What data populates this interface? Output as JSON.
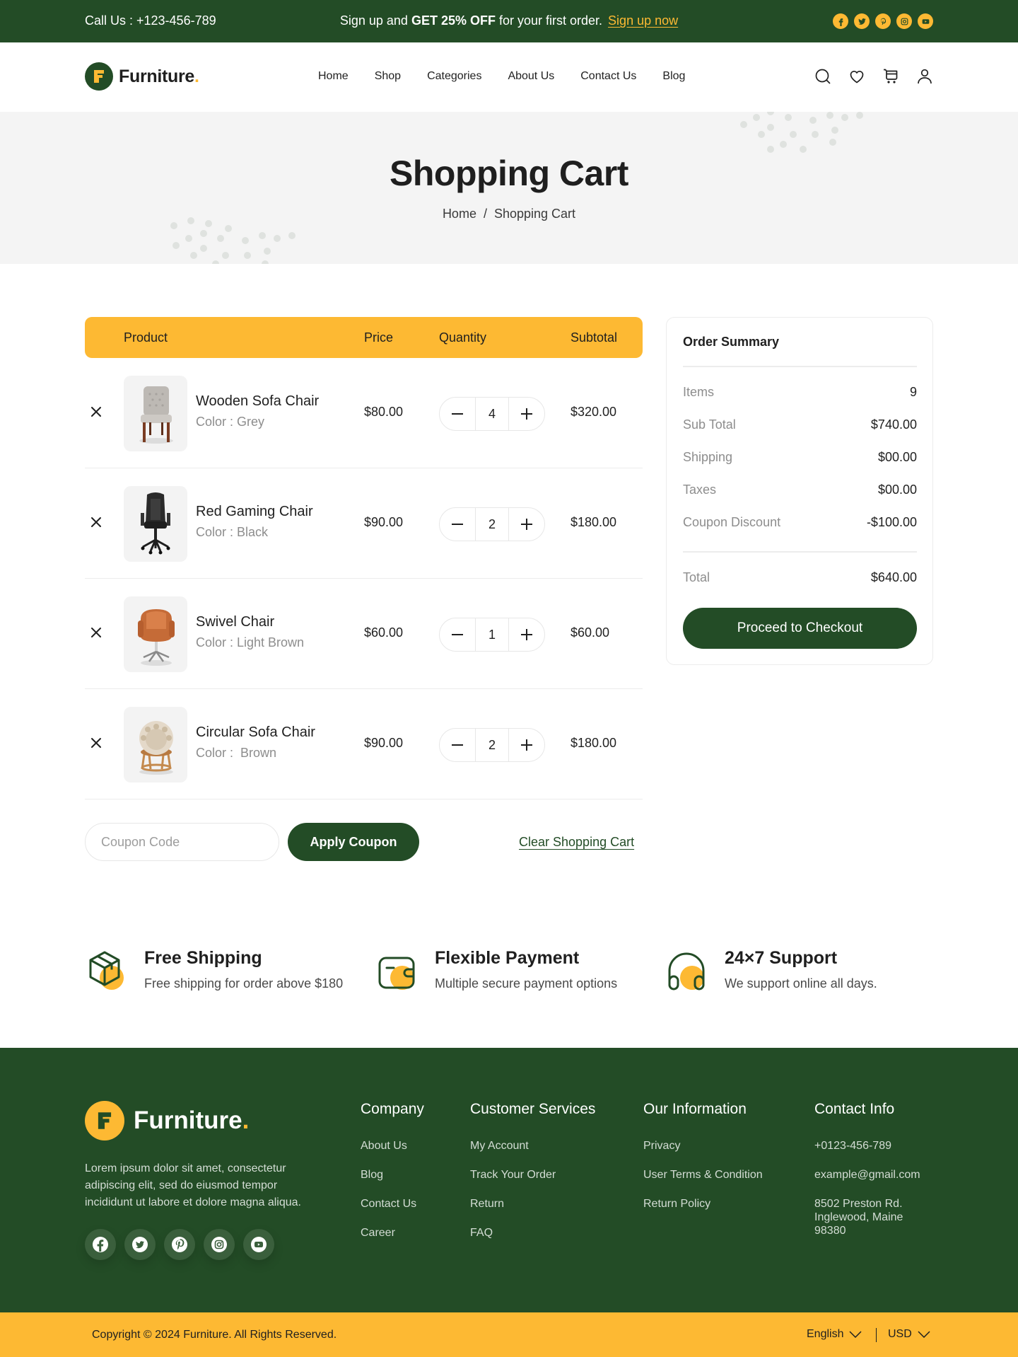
{
  "topbar": {
    "call_label": "Call Us :  +123-456-789",
    "promo_prefix": "Sign up and ",
    "promo_bold": "GET 25% OFF",
    "promo_suffix": " for your first order.",
    "signup_link": "Sign up now",
    "socials": [
      "facebook-icon",
      "twitter-icon",
      "pinterest-icon",
      "instagram-icon",
      "youtube-icon"
    ]
  },
  "nav": {
    "brand": "Furniture",
    "brand_dot": ".",
    "menu": [
      "Home",
      "Shop",
      "Categories",
      "About Us",
      "Contact Us",
      "Blog"
    ],
    "icons": [
      "search-icon",
      "heart-icon",
      "cart-icon",
      "user-icon"
    ]
  },
  "hero": {
    "title": "Shopping Cart",
    "breadcrumb": [
      "Home",
      "/",
      "Shopping Cart"
    ]
  },
  "cart": {
    "columns": [
      "Product",
      "Price",
      "Quantity",
      "Subtotal"
    ],
    "items": [
      {
        "name": "Wooden Sofa Chair",
        "color": "Color : Grey",
        "price": "$80.00",
        "quantity": "4",
        "subtotal": "$320.00",
        "image": "grey-tufted-dining-chair"
      },
      {
        "name": "Red Gaming Chair",
        "color": "Color : Black",
        "price": "$90.00",
        "quantity": "2",
        "subtotal": "$180.00",
        "image": "black-gaming-chair"
      },
      {
        "name": "Swivel Chair",
        "color": "Color : Light Brown",
        "price": "$60.00",
        "quantity": "1",
        "subtotal": "$60.00",
        "image": "tan-leather-swivel-chair"
      },
      {
        "name": "Circular Sofa Chair",
        "color": "Color :  Brown",
        "price": "$90.00",
        "quantity": "2",
        "subtotal": "$180.00",
        "image": "papasan-chair"
      }
    ],
    "coupon_placeholder": "Coupon Code",
    "coupon_value": "",
    "apply_label": "Apply Coupon",
    "clear_label": "Clear Shopping Cart"
  },
  "summary": {
    "title": "Order Summary",
    "rows": [
      {
        "label": "Items",
        "value": "9"
      },
      {
        "label": "Sub Total",
        "value": "$740.00"
      },
      {
        "label": "Shipping",
        "value": "$00.00"
      },
      {
        "label": "Taxes",
        "value": "$00.00"
      },
      {
        "label": "Coupon Discount",
        "value": "-$100.00"
      }
    ],
    "total_label": "Total",
    "total_value": "$640.00",
    "checkout_label": "Proceed to Checkout"
  },
  "features": [
    {
      "icon": "package-icon",
      "title": "Free Shipping",
      "desc": "Free shipping for order above $180"
    },
    {
      "icon": "wallet-icon",
      "title": "Flexible Payment",
      "desc": "Multiple secure payment options"
    },
    {
      "icon": "headphones-icon",
      "title": "24×7 Support",
      "desc": "We support online all days."
    }
  ],
  "footer": {
    "brand": "Furniture",
    "brand_dot": ".",
    "about": "Lorem ipsum dolor sit amet, consectetur adipiscing elit, sed do eiusmod tempor incididunt ut labore et dolore magna aliqua.",
    "socials": [
      "facebook-icon",
      "twitter-icon",
      "pinterest-icon",
      "instagram-icon",
      "youtube-icon"
    ],
    "columns": [
      {
        "title": "Company",
        "links": [
          "About Us",
          "Blog",
          "Contact Us",
          "Career"
        ]
      },
      {
        "title": "Customer Services",
        "links": [
          "My Account",
          "Track Your Order",
          "Return",
          "FAQ"
        ]
      },
      {
        "title": "Our Information",
        "links": [
          "Privacy",
          "User Terms & Condition",
          "Return Policy"
        ]
      },
      {
        "title": "Contact Info",
        "links": [
          "+0123-456-789",
          "example@gmail.com",
          "8502 Preston Rd.\nInglewood, Maine\n98380"
        ]
      }
    ],
    "copyright": "Copyright © 2024 Furniture. All Rights Reserved.",
    "language": "English",
    "currency": "USD"
  },
  "colors": {
    "brand_green": "#234c26",
    "accent_yellow": "#fdb933",
    "hero_bg": "#f4f4f4"
  }
}
